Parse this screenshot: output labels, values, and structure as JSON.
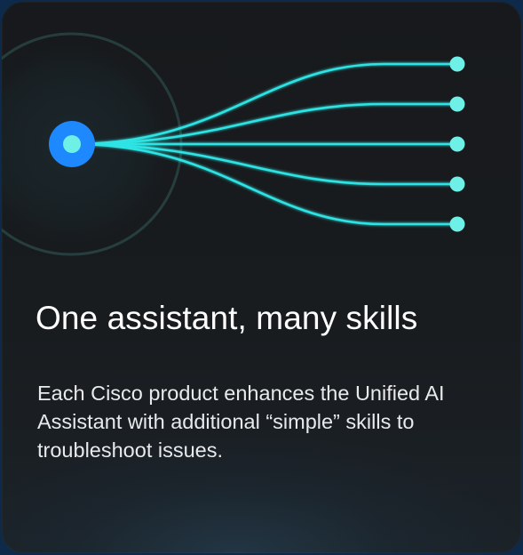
{
  "card": {
    "headline": "One assistant, many skills",
    "body": "Each Cisco product enhances the Unified AI Assistant with additional “simple” skills to troubleshoot issues."
  },
  "colors": {
    "background": "#0e2a4a",
    "card": "#17191c",
    "hub": "#1e88ff",
    "skill_line": "#2fe3e3",
    "skill_node": "#6ff0e6"
  },
  "illustration": {
    "hub_icon": "assistant-hub-icon",
    "skill_icon": "skill-node-icon",
    "skill_count": 5
  }
}
